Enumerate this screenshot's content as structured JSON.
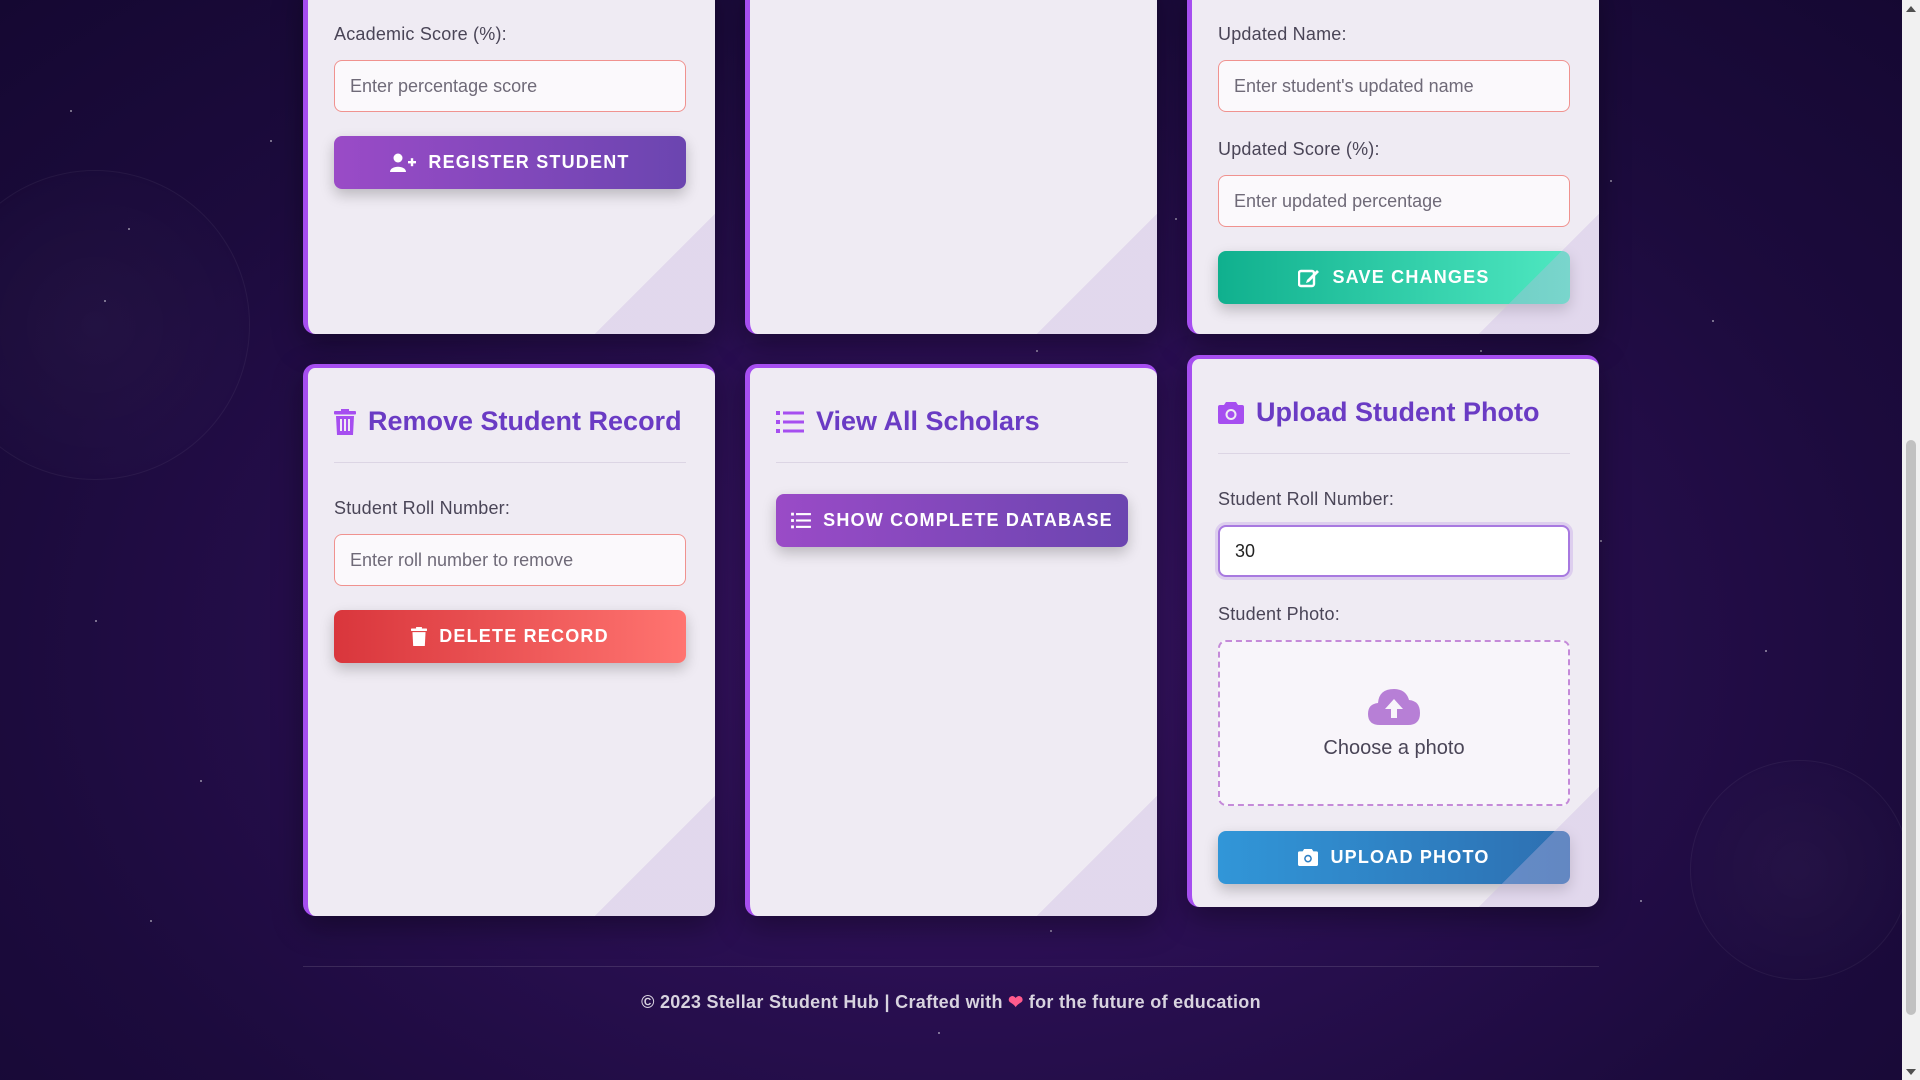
{
  "colors": {
    "accent": "#a64ef0",
    "title": "#6a3bc4",
    "card_bg": "#efebf3",
    "input_border": "#f0928f",
    "background": "#1c0b3d"
  },
  "register_card": {
    "score_label": "Academic Score (%):",
    "score_placeholder": "Enter percentage score",
    "register_button_label": "REGISTER STUDENT",
    "register_icon": "user-plus-icon"
  },
  "update_card": {
    "name_label": "Updated Name:",
    "name_placeholder": "Enter student's updated name",
    "score_label": "Updated Score (%):",
    "score_placeholder": "Enter updated percentage",
    "save_button_label": "SAVE CHANGES",
    "save_icon": "edit-icon"
  },
  "remove_card": {
    "title": "Remove Student Record",
    "title_icon": "trash-icon",
    "roll_label": "Student Roll Number:",
    "roll_placeholder": "Enter roll number to remove",
    "delete_button_label": "DELETE RECORD",
    "delete_icon": "trash-icon"
  },
  "view_card": {
    "title": "View All Scholars",
    "title_icon": "list-icon",
    "show_button_label": "SHOW COMPLETE DATABASE",
    "show_icon": "list-icon"
  },
  "upload_card": {
    "title": "Upload Student Photo",
    "title_icon": "camera-icon",
    "roll_label": "Student Roll Number:",
    "roll_value": "30",
    "photo_label": "Student Photo:",
    "dropzone_text": "Choose a photo",
    "dropzone_icon": "cloud-upload-icon",
    "upload_button_label": "UPLOAD PHOTO",
    "upload_icon": "camera-icon"
  },
  "footer": {
    "text_before": "© 2023 Stellar Student Hub | Crafted with",
    "heart": "❤",
    "text_after": "for the future of education"
  }
}
